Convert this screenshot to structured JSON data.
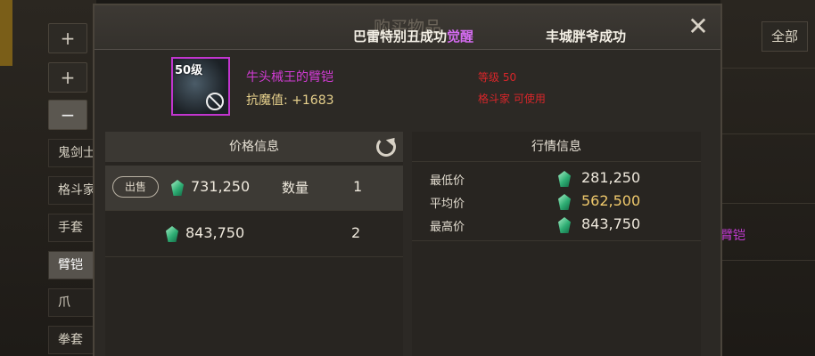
{
  "sidebar": {
    "plus_1": "+",
    "plus_2": "+",
    "minus": "−",
    "items": [
      "鬼剑士",
      "格斗家",
      "手套",
      "臂铠",
      "爪",
      "拳套"
    ]
  },
  "right_panel": {
    "filter_label": "全部",
    "row_text": "臂铠"
  },
  "modal": {
    "title": "购买物品",
    "ticker_1_prefix": "巴雷特别丑成功",
    "ticker_1_highlight": "觉醒",
    "ticker_2": "丰城胖爷成功",
    "close_label": "✕"
  },
  "item": {
    "level_badge": "50级",
    "name": "牛头械王的臂铠",
    "stat_label": "抗魔值: ",
    "stat_value": "+1683",
    "req_level": "等级 50",
    "req_class": "格斗家 可使用"
  },
  "price_info": {
    "header": "价格信息",
    "sell_label": "出售",
    "qty_label": "数量",
    "rows": [
      {
        "price": "731,250",
        "qty": "1"
      },
      {
        "price": "843,750",
        "qty": "2"
      }
    ]
  },
  "market_info": {
    "header": "行情信息",
    "min_label": "最低价",
    "min_value": "281,250",
    "avg_label": "平均价",
    "avg_value": "562,500",
    "max_label": "最高价",
    "max_value": "843,750"
  },
  "colors": {
    "epic_purple": "#d13bd3",
    "requirement_red": "#d8262a",
    "average_gold": "#efc96c",
    "currency_green": "#2fae74"
  },
  "icons": [
    "close-icon",
    "refresh-icon",
    "gem-icon",
    "forbidden-icon"
  ]
}
